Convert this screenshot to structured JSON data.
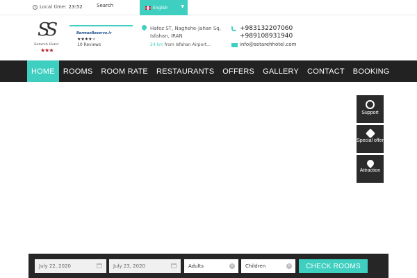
{
  "topbar": {
    "local_time_label": "Local time:",
    "local_time_value": "23:52",
    "search_label": "Search",
    "language": "English"
  },
  "logo": {
    "mark": "SS",
    "name": "Setareh Hotel",
    "stars": "★★★"
  },
  "reviews": {
    "brand": "BermanReserve.ir",
    "rating_filled": "★★★★",
    "rating_empty": "★",
    "count": "10 Reviews"
  },
  "address": {
    "line1": "Hafez ST, Naghshe-Jahan Sq,",
    "line2": "Isfahan, IRAN",
    "distance_value": "24 km",
    "distance_text": "from Isfahan Airport..."
  },
  "contact": {
    "phone1": "+983132207060",
    "phone2": "+989108931940",
    "email": "info@setarehhotel.com"
  },
  "nav": {
    "items": [
      {
        "label": "HOME"
      },
      {
        "label": "ROOMS"
      },
      {
        "label": "ROOM RATE"
      },
      {
        "label": "RESTAURANTS"
      },
      {
        "label": "OFFERS"
      },
      {
        "label": "GALLERY"
      },
      {
        "label": "CONTACT"
      },
      {
        "label": "BOOKING"
      }
    ]
  },
  "side_widgets": {
    "support": "Support",
    "special_offer": "Special offer",
    "attraction": "Attraction"
  },
  "booking": {
    "checkin": "July 22, 2020",
    "checkout": "July 23, 2020",
    "adults_placeholder": "Adults",
    "children_placeholder": "Children",
    "check_button": "CHECK ROOMS"
  },
  "colors": {
    "accent": "#3fcfc1",
    "nav_bg": "#222222",
    "logo_star": "#b3242c"
  }
}
